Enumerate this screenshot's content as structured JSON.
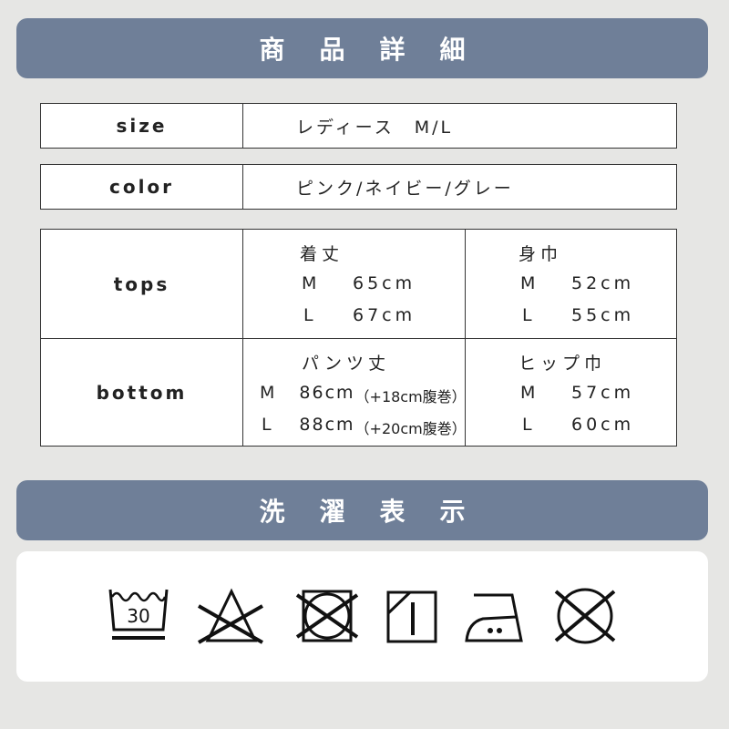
{
  "product_details": {
    "heading": "商品詳細",
    "size": {
      "label": "size",
      "value": "レディース　M/L"
    },
    "color": {
      "label": "color",
      "value": "ピンク/ネイビー/グレー"
    },
    "tops": {
      "label": "tops",
      "length": {
        "heading": "着丈",
        "rows": [
          {
            "size": "M",
            "value": "65cm"
          },
          {
            "size": "L",
            "value": "67cm"
          }
        ]
      },
      "width": {
        "heading": "身巾",
        "rows": [
          {
            "size": "M",
            "value": "52cm"
          },
          {
            "size": "L",
            "value": "55cm"
          }
        ]
      }
    },
    "bottom": {
      "label": "bottom",
      "length": {
        "heading": "パンツ丈",
        "rows": [
          {
            "size": "M",
            "value": "86cm",
            "note": "（+18cm腹巻）"
          },
          {
            "size": "L",
            "value": "88cm",
            "note": "（+20cm腹巻）"
          }
        ]
      },
      "width": {
        "heading": "ヒップ巾",
        "rows": [
          {
            "size": "M",
            "value": "57cm"
          },
          {
            "size": "L",
            "value": "60cm"
          }
        ]
      }
    }
  },
  "care": {
    "heading": "洗濯表示",
    "icons": [
      {
        "name": "wash-30-gentle-icon",
        "text": "30"
      },
      {
        "name": "no-bleach-icon"
      },
      {
        "name": "no-tumble-dry-icon"
      },
      {
        "name": "line-dry-shade-icon"
      },
      {
        "name": "iron-medium-icon"
      },
      {
        "name": "no-dry-clean-icon"
      }
    ]
  },
  "colors": {
    "banner": "#6f7f98",
    "background": "#e6e6e4"
  }
}
